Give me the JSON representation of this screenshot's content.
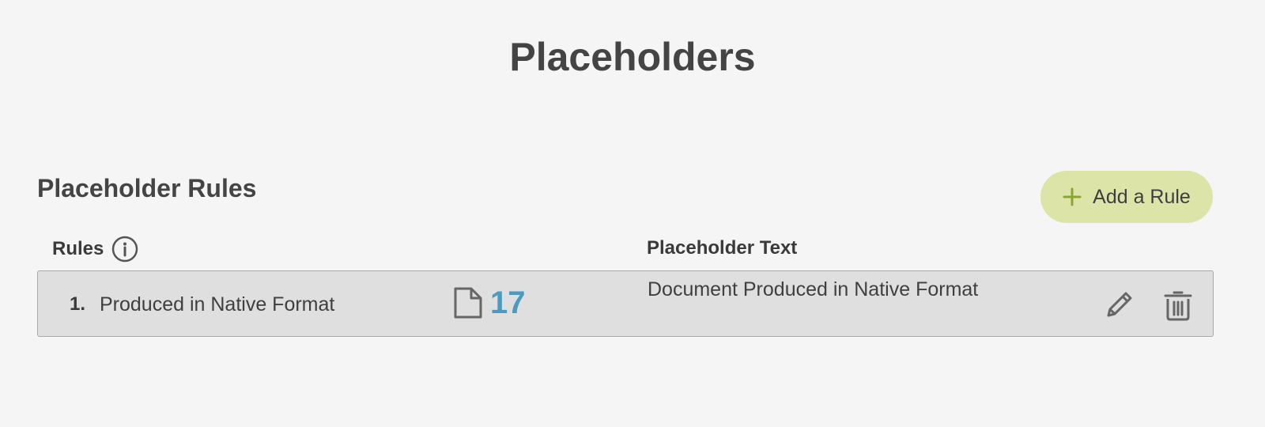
{
  "page": {
    "title": "Placeholders"
  },
  "section": {
    "title": "Placeholder Rules",
    "add_button_label": "Add a Rule"
  },
  "table": {
    "headers": {
      "rules": "Rules",
      "placeholder_text": "Placeholder Text"
    },
    "rows": [
      {
        "number": "1.",
        "name": "Produced in Native Format",
        "document_count": "17",
        "placeholder_text": "Document Produced in Native Format"
      }
    ]
  },
  "icons": {
    "plus": "plus-icon",
    "info": "info-icon",
    "document": "document-icon",
    "edit": "pencil-icon",
    "delete": "trash-icon"
  },
  "colors": {
    "background": "#f5f5f5",
    "add_button_bg": "#dde4a8",
    "plus_icon": "#8aa631",
    "row_bg": "#dfdfdf",
    "row_border": "#a8a8a8",
    "count_color": "#4a9bbf",
    "text": "#3f3f3f"
  }
}
